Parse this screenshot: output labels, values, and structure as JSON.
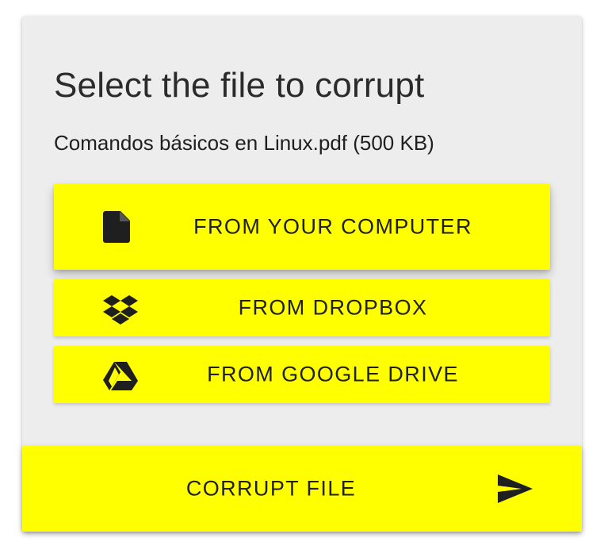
{
  "panel": {
    "title": "Select the file to corrupt",
    "selected_file": "Comandos básicos en Linux.pdf (500 KB)"
  },
  "sources": [
    {
      "label": "FROM YOUR COMPUTER",
      "icon": "file-icon"
    },
    {
      "label": "FROM DROPBOX",
      "icon": "dropbox-icon"
    },
    {
      "label": "FROM GOOGLE DRIVE",
      "icon": "google-drive-icon"
    }
  ],
  "action": {
    "label": "CORRUPT FILE",
    "icon": "send-icon"
  },
  "colors": {
    "button_bg": "#ffff00",
    "card_bg": "#ededed",
    "text": "#1f1f1f"
  }
}
